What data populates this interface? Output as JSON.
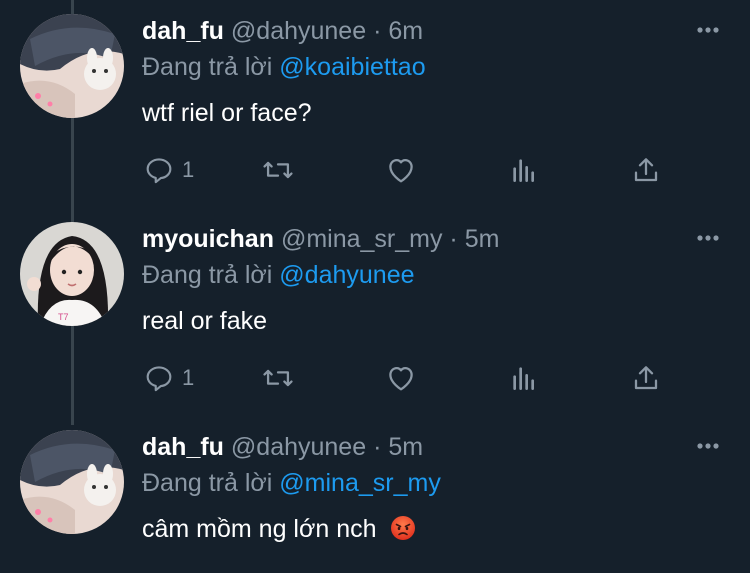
{
  "colors": {
    "background": "#15202b",
    "text": "#ffffff",
    "secondary": "#8b98a5",
    "mention": "#1d9bf0",
    "thread_line": "#38444d"
  },
  "tweets": [
    {
      "display_name": "dah_fu",
      "handle": "@dahyunee",
      "separator": "·",
      "time": "6m",
      "replying_prefix": "Đang trả lời",
      "replying_to": "@koaibiettao",
      "text": "wtf riel or face?",
      "reply_count": "1",
      "icons": [
        "reply-icon",
        "retweet-icon",
        "like-icon",
        "analytics-icon",
        "share-icon",
        "more-icon"
      ]
    },
    {
      "display_name": "myouichan",
      "handle": "@mina_sr_my",
      "separator": "·",
      "time": "5m",
      "replying_prefix": "Đang trả lời",
      "replying_to": "@dahyunee",
      "text": "real or fake",
      "reply_count": "1",
      "icons": [
        "reply-icon",
        "retweet-icon",
        "like-icon",
        "analytics-icon",
        "share-icon",
        "more-icon"
      ]
    },
    {
      "display_name": "dah_fu",
      "handle": "@dahyunee",
      "separator": "·",
      "time": "5m",
      "replying_prefix": "Đang trả lời",
      "replying_to": "@mina_sr_my",
      "text": "câm mồm ng lớn nch",
      "emoji": "angry-face-emoji",
      "icons": [
        "more-icon"
      ]
    }
  ]
}
